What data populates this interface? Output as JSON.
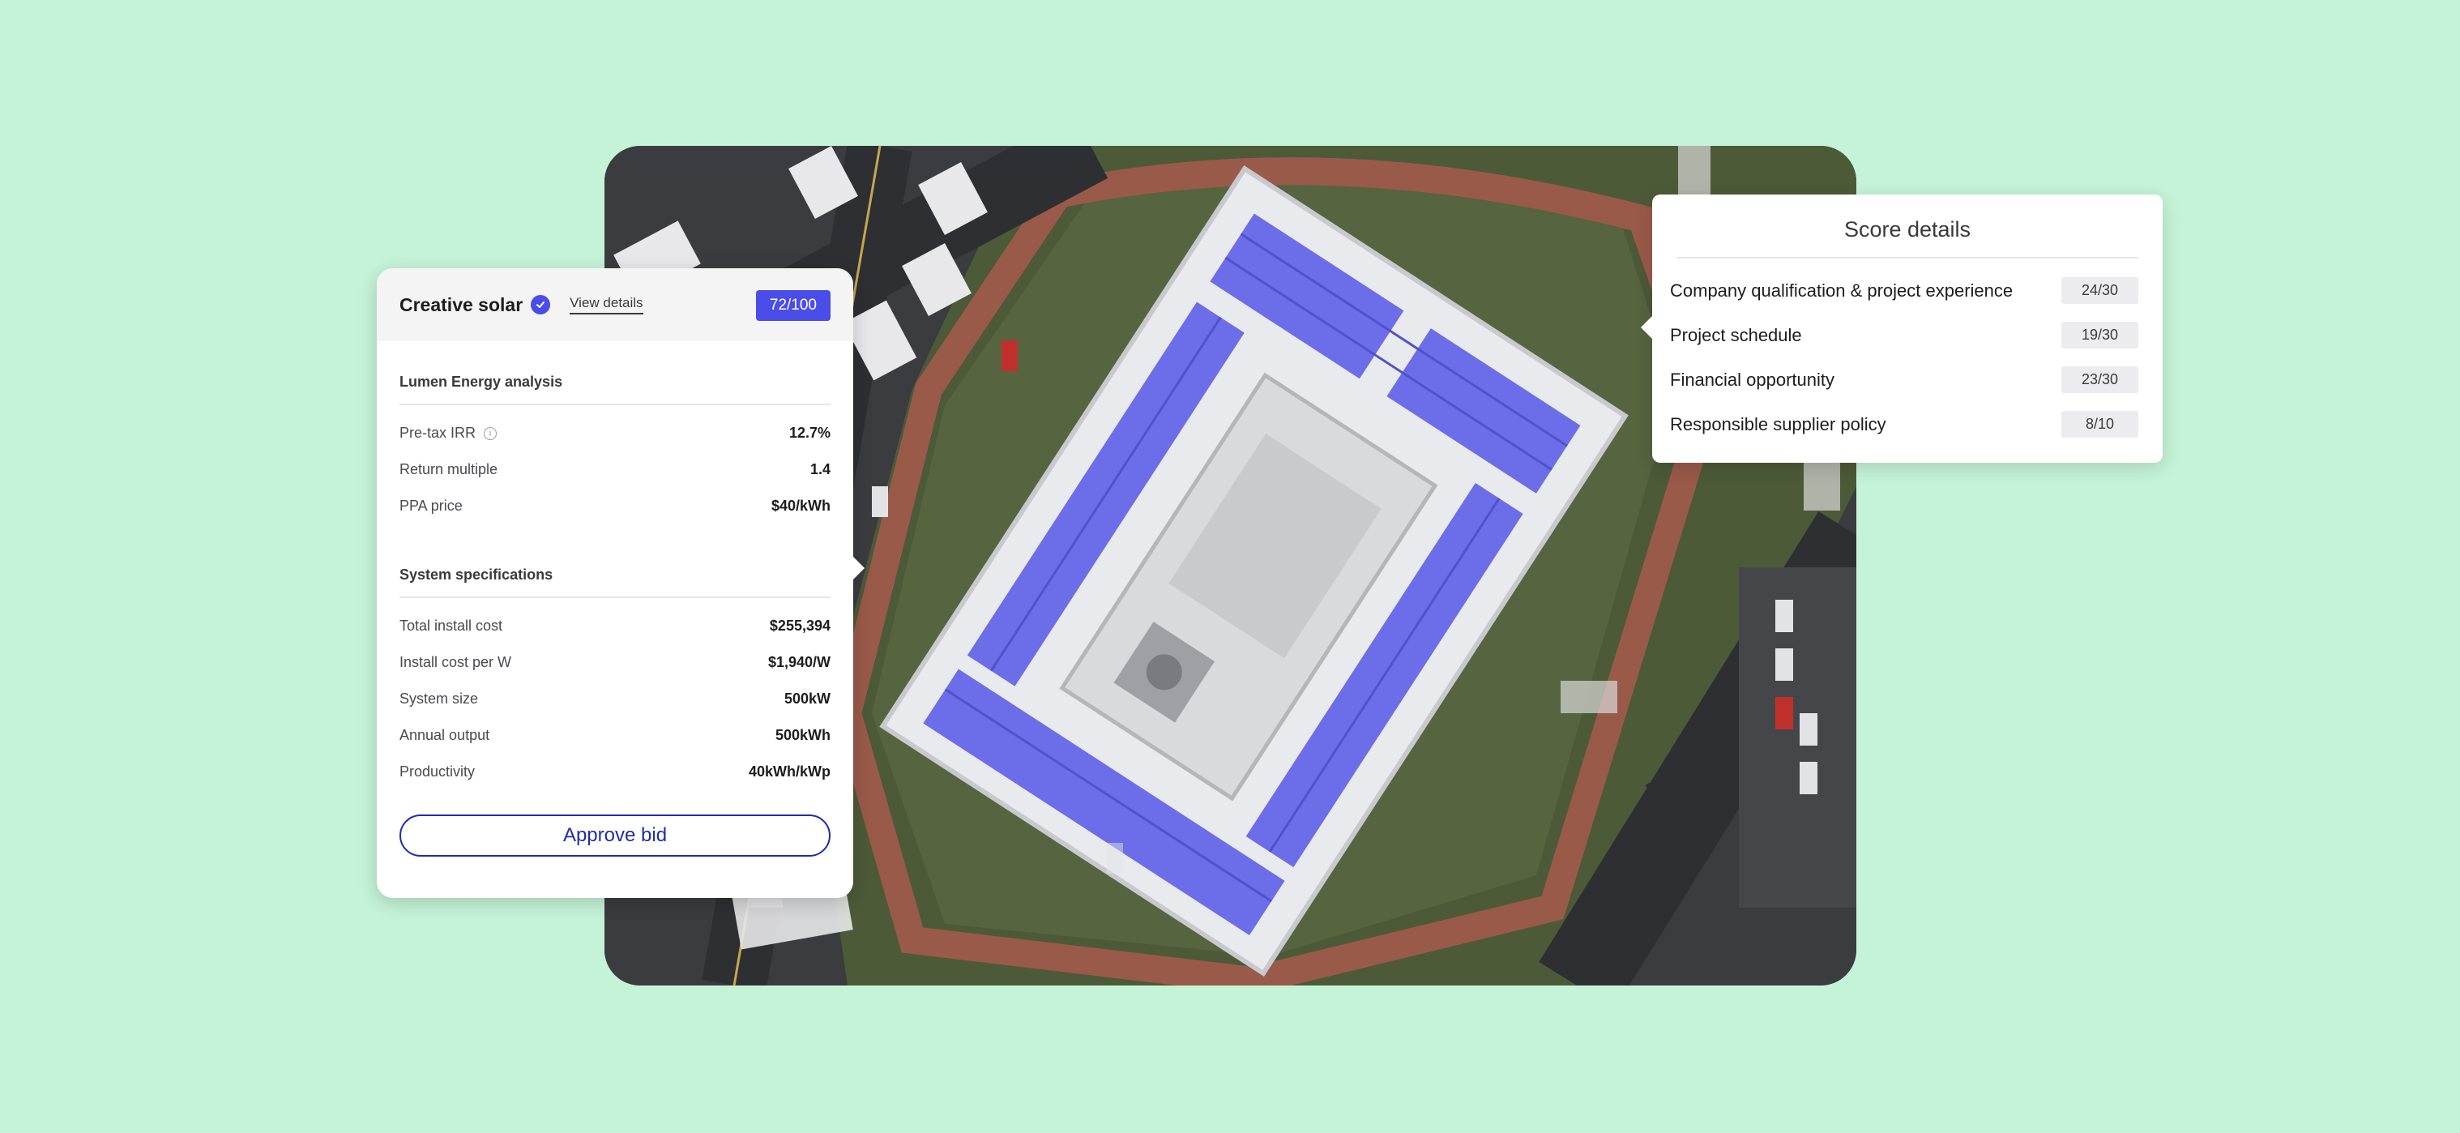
{
  "bid": {
    "company": "Creative solar",
    "view_details": "View details",
    "score": "72/100",
    "analysis_title": "Lumen Energy analysis",
    "analysis": [
      {
        "label": "Pre-tax IRR",
        "value": "12.7%",
        "info": true
      },
      {
        "label": "Return multiple",
        "value": "1.4"
      },
      {
        "label": "PPA price",
        "value": "$40/kWh"
      }
    ],
    "specs_title": "System specifications",
    "specs": [
      {
        "label": "Total install cost",
        "value": "$255,394"
      },
      {
        "label": "Install cost per W",
        "value": "$1,940/W"
      },
      {
        "label": "System size",
        "value": "500kW"
      },
      {
        "label": "Annual output",
        "value": "500kWh"
      },
      {
        "label": "Productivity",
        "value": "40kWh/kWp"
      }
    ],
    "approve_label": "Approve bid"
  },
  "score_details": {
    "title": "Score details",
    "items": [
      {
        "label": "Company qualification & project experience",
        "score": "24/30"
      },
      {
        "label": "Project schedule",
        "score": "19/30"
      },
      {
        "label": "Financial opportunity",
        "score": "23/30"
      },
      {
        "label": "Responsible supplier policy",
        "score": "8/10"
      }
    ]
  },
  "colors": {
    "background": "#c5f3d7",
    "accent": "#4a4de8",
    "button_outline": "#1f2bb0",
    "solar_panel": "#6b6ee8"
  },
  "icons": {
    "verified": "verified-check-icon",
    "info": "info-icon"
  }
}
